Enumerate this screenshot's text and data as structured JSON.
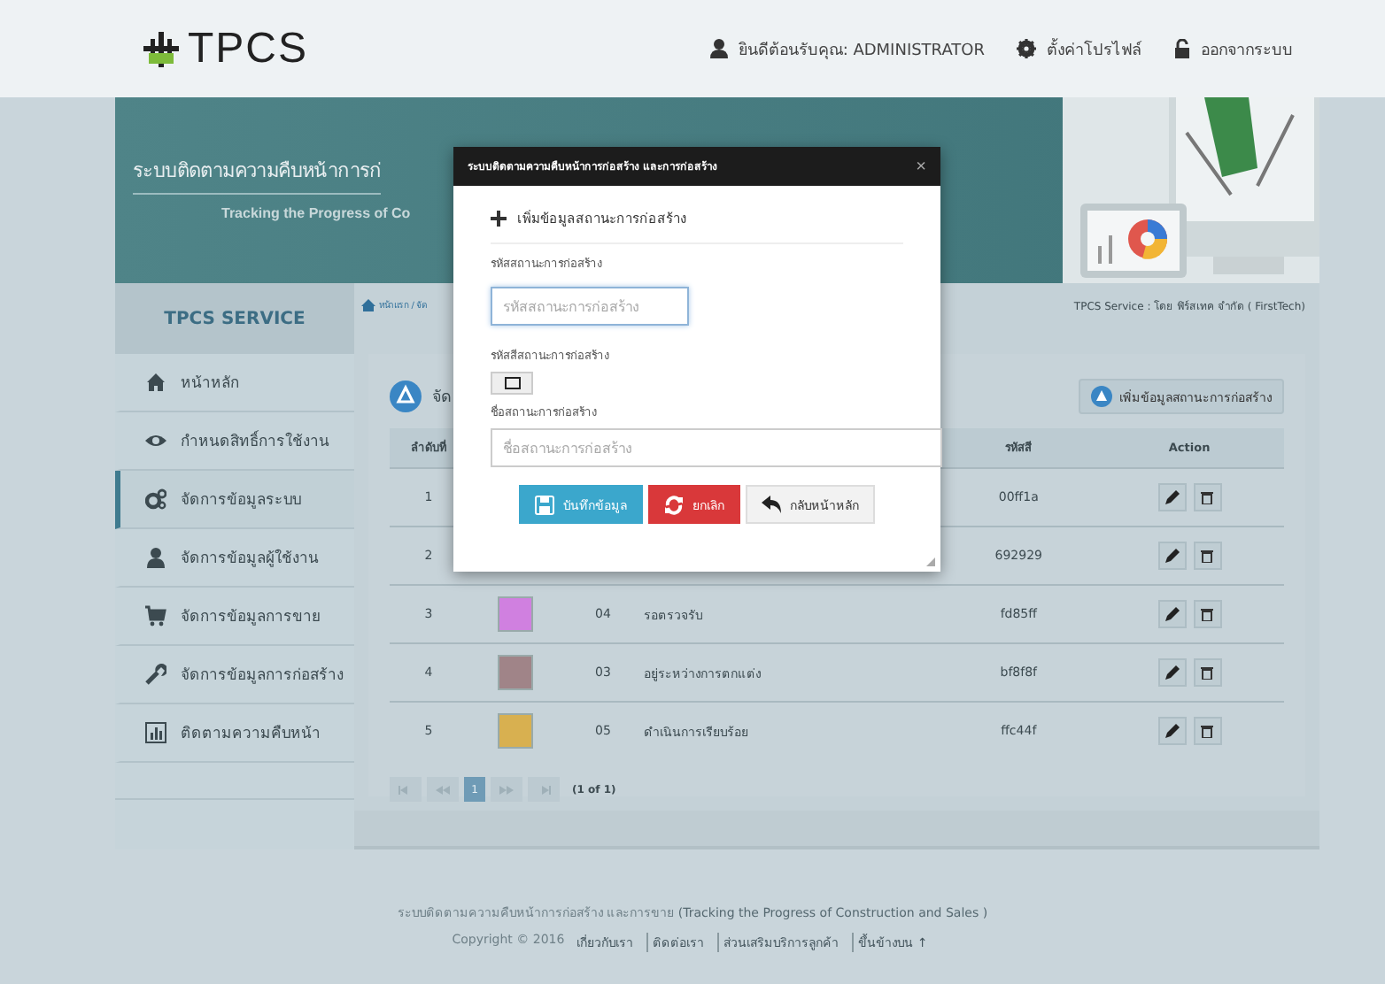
{
  "header": {
    "logo": "TPCS",
    "welcome": "ยินดีต้อนรับคุณ: ADMINISTRATOR",
    "profile": "ตั้งค่าโปรไฟล์",
    "logout": "ออกจากระบบ"
  },
  "banner": {
    "title": "ระบบติดตามความคืบหน้าการก่",
    "subtitle": "Tracking the Progress of Co"
  },
  "sidebar": {
    "title": "TPCS SERVICE",
    "items": [
      {
        "label": "หน้าหลัก",
        "kind": "home",
        "selected": false
      },
      {
        "label": "กำหนดสิทธิ์การใช้งาน",
        "kind": "permissions",
        "selected": false
      },
      {
        "label": "จัดการข้อมูลระบบ",
        "kind": "system",
        "selected": true
      },
      {
        "label": "จัดการข้อมูลผู้ใช้งาน",
        "kind": "users",
        "selected": false
      },
      {
        "label": "จัดการข้อมูลการขาย",
        "kind": "sales",
        "selected": false
      },
      {
        "label": "จัดการข้อมูลการก่อสร้าง",
        "kind": "construction",
        "selected": false
      },
      {
        "label": "ติดตามความคืบหน้า",
        "kind": "tracking",
        "selected": false
      }
    ]
  },
  "breadcrumb": {
    "path": "หน้าแรก / จัด",
    "credit": "TPCS Service : โดย ฟิร์สเทค จำกัด ( FirstTech)"
  },
  "panel": {
    "title": "จัด",
    "add_button": "เพิ่มข้อมูลสถานะการก่อสร้าง",
    "headers": {
      "column_1": "ลำดับที่",
      "column_5": "รหัสสี",
      "column_6": "Action"
    },
    "rows": [
      {
        "no": "1",
        "color_code": "00ff1a"
      },
      {
        "no": "2",
        "color_code": "692929"
      },
      {
        "no": "3",
        "color": "#d080e0",
        "code": "04",
        "name": "รอตรวจรับ",
        "color_code": "fd85ff"
      },
      {
        "no": "4",
        "color": "#a08488",
        "code": "03",
        "name": "อยู่ระหว่างการตกแต่ง",
        "color_code": "bf8f8f"
      },
      {
        "no": "5",
        "color": "#d8b050",
        "code": "05",
        "name": "ดำเนินการเรียบร้อย",
        "color_code": "ffc44f"
      }
    ],
    "pagination": {
      "pages": [
        {
          "label": "1",
          "selected": true
        }
      ],
      "summary": "(1 of 1)"
    }
  },
  "modal": {
    "title": "ระบบติดตามความคืบหน้าการก่อสร้าง และการก่อสร้าง",
    "close": "×",
    "section": "เพิ่มข้อมูลสถานะการก่อสร้าง",
    "fields": [
      {
        "kind": "text",
        "label": "รหัสสถานะการก่อสร้าง",
        "placeholder": "รหัสสถานะการก่อสร้าง",
        "focused": true
      },
      {
        "kind": "color",
        "label": "รหัสสีสถานะการก่อสร้าง"
      },
      {
        "kind": "text",
        "label": "ชื่อสถานะการก่อสร้าง",
        "placeholder": "ชื่อสถานะการก่อสร้าง",
        "focused": false
      }
    ],
    "buttons": [
      {
        "kind": "save",
        "label": "บันทึกข้อมูล"
      },
      {
        "kind": "cancel",
        "label": "ยกเลิก"
      },
      {
        "kind": "back",
        "label": "กลับหน้าหลัก"
      }
    ]
  },
  "footer": {
    "line": "ระบบติดตามความคืบหน้าการก่อสร้าง และการขาย",
    "english": "(Tracking the Progress of Construction and Sales )",
    "copyright": "Copyright © 2016",
    "links": [
      "เกี่ยวกับเรา",
      "ติดต่อเรา",
      "ส่วนเสริมบริการลูกค้า",
      "ขึ้นข้างบน ↑"
    ]
  }
}
